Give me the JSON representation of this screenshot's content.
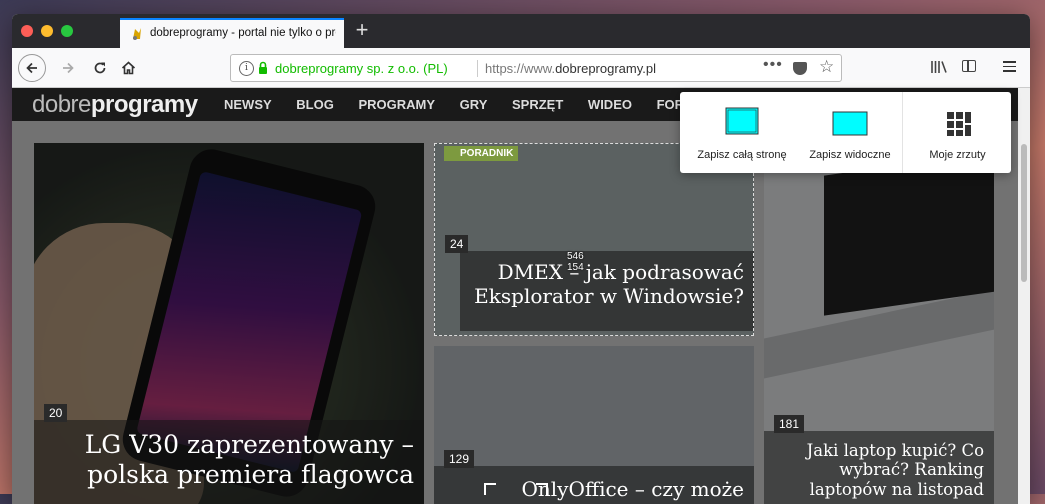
{
  "browser": {
    "tab": {
      "title": "dobreprogramy - portal nie tylko o programach",
      "favicon": "dobreprogramy-favicon"
    },
    "new_tab_label": "+",
    "urlbar": {
      "identity": "dobreprogramy sp. z o.o. (PL)",
      "url_prefix": "https://www.",
      "url_domain": "dobreprogramy.pl",
      "more_label": "•••"
    },
    "icons": {
      "back": "back-arrow-icon",
      "forward": "forward-arrow-icon",
      "reload": "reload-icon",
      "home": "home-icon",
      "info": "info-icon",
      "lock": "lock-icon",
      "pocket": "pocket-icon",
      "bookmark": "star-icon",
      "library": "library-icon",
      "sidebar": "sidebar-icon",
      "menu": "hamburger-menu-icon"
    },
    "colors": {
      "accent": "#0a84ff",
      "secure": "#12bc00",
      "titlebar": "#2a2a2e"
    }
  },
  "site": {
    "logo_light": "dobre",
    "logo_bold": "programy",
    "nav": [
      "NEWSY",
      "BLOG",
      "PROGRAMY",
      "GRY",
      "SPRZĘT",
      "WIDEO",
      "FORUM"
    ],
    "articles": [
      {
        "comments": "20",
        "title": "LG V30 zaprezentowany – polska premiera flagowca"
      },
      {
        "comments": "24",
        "tag": "PORADNIK",
        "title": "DMEX – jak podrasować Eksplorator w Windowsie?"
      },
      {
        "comments": "129",
        "title": "OnlyOffice – czy może"
      },
      {
        "comments": "181",
        "title": "Jaki laptop kupić? Co wybrać? Ranking laptopów na listopad"
      }
    ],
    "selection_size": {
      "width": "546",
      "height": "154"
    }
  },
  "screenshot_panel": {
    "full_page": "Zapisz całą stronę",
    "visible": "Zapisz widoczne",
    "my_shots": "Moje zrzuty",
    "icon_color": "#00fdff"
  }
}
